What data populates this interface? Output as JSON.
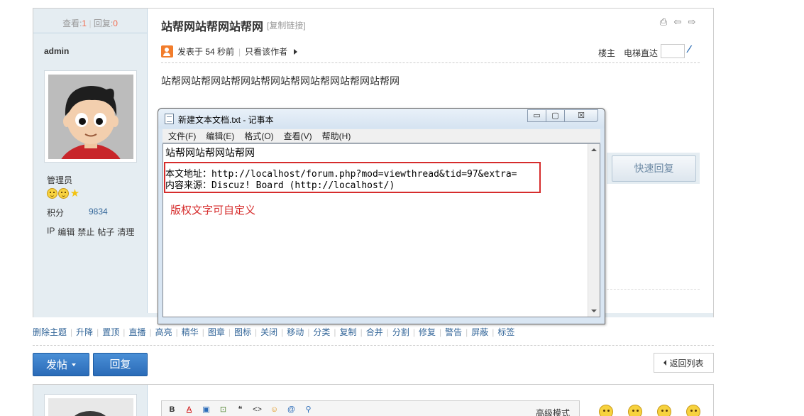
{
  "stats": {
    "views_label": "查看:",
    "views": "1",
    "replies_label": "回复:",
    "replies": "0"
  },
  "author": {
    "name": "admin",
    "group": "管理员",
    "points_label": "积分",
    "points": "9834",
    "admin_links": [
      "IP",
      "编辑",
      "禁止",
      "帖子",
      "清理"
    ]
  },
  "thread": {
    "title": "站帮网站帮网站帮网",
    "copy_link": "[复制链接]",
    "posted_at": "发表于 54 秒前",
    "only_author": "只看该作者",
    "floor": "楼主",
    "elevator": "电梯直达",
    "content": "站帮网站帮网站帮网站帮网站帮网站帮网站帮网站帮网"
  },
  "quick_reply": "快速回复",
  "notepad": {
    "title": "新建文本文档.txt - 记事本",
    "minimize": "▭",
    "maximize": "▢",
    "close": "☒",
    "menu": [
      "文件(F)",
      "编辑(E)",
      "格式(O)",
      "查看(V)",
      "帮助(H)"
    ],
    "line1": "站帮网站帮网站帮网",
    "line2": "本文地址：http://localhost/forum.php?mod=viewthread&tid=97&extra=",
    "line3": "内容来源：Discuz! Board (http://localhost/)",
    "annotation": "版权文字可自定义"
  },
  "mod_actions": [
    "删除主题",
    "升降",
    "置顶",
    "直播",
    "高亮",
    "精华",
    "图章",
    "图标",
    "关闭",
    "移动",
    "分类",
    "复制",
    "合并",
    "分割",
    "修复",
    "警告",
    "屏蔽",
    "标签"
  ],
  "buttons": {
    "post": "发帖",
    "reply": "回复",
    "back": "返回列表"
  },
  "editor": {
    "tools": [
      "B",
      "A",
      "▣",
      "⊡",
      "❝",
      "<>",
      "☺",
      "@",
      "⚲"
    ],
    "advanced_mode": "高级模式"
  },
  "colors": {
    "link": "#336699",
    "accent_red": "#d62c2c",
    "button_blue": "#2a6bb8",
    "side_bg": "#e5edf2"
  }
}
